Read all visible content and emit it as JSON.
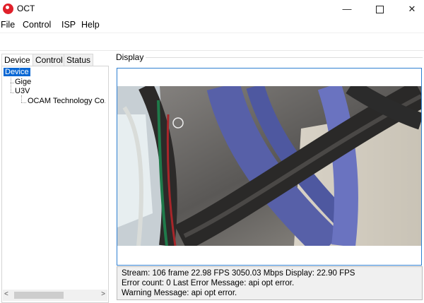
{
  "window": {
    "title": "OCT",
    "min_glyph": "—",
    "close_glyph": "✕"
  },
  "menu": [
    "File",
    "Control",
    "ISP",
    "Help"
  ],
  "tabs": [
    "Device",
    "Control",
    "Status"
  ],
  "tree": {
    "root": "Device",
    "children": [
      "Gige",
      "U3V"
    ],
    "u3v_children": [
      "OCAM Technology Co., L"
    ]
  },
  "scrollbar": {
    "left_arrow": "<",
    "right_arrow": ">"
  },
  "display": {
    "label": "Display"
  },
  "status": {
    "stream_line": "Stream: 106 frame  22.98 FPS  3050.03 Mbps  Display: 22.90 FPS",
    "error_line": "Error count: 0  Last Error Message: api opt error.",
    "warning_line": "Warning Message: api opt error."
  },
  "colors": {
    "selection": "#0a68d4",
    "frame_border": "#2e7fd1",
    "app_icon": "#e0202a"
  }
}
